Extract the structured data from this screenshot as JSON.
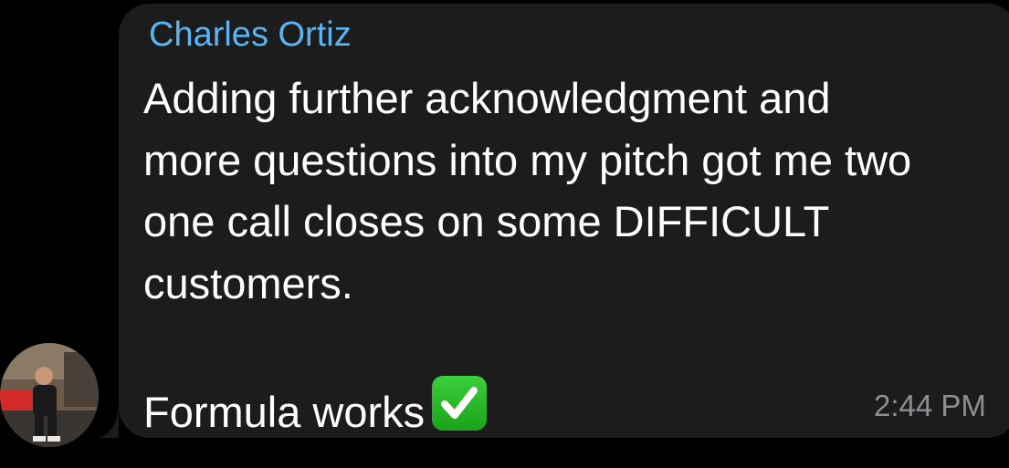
{
  "sender": {
    "name": "Charles Ortiz"
  },
  "message": {
    "line1": "Adding further acknowledgment and",
    "line2": "more questions into my pitch got me two",
    "line3": "one call closes on some DIFFICULT",
    "line4": "customers.",
    "closing": "Formula works",
    "emoji_icon": "white-heavy-check-mark-icon"
  },
  "timestamp": "2:44 PM",
  "colors": {
    "background": "#000000",
    "bubble": "#1c1c1d",
    "sender_name": "#5bb4f2",
    "text": "#ffffff",
    "timestamp": "#8e8e93",
    "check_green": "#22b422"
  }
}
